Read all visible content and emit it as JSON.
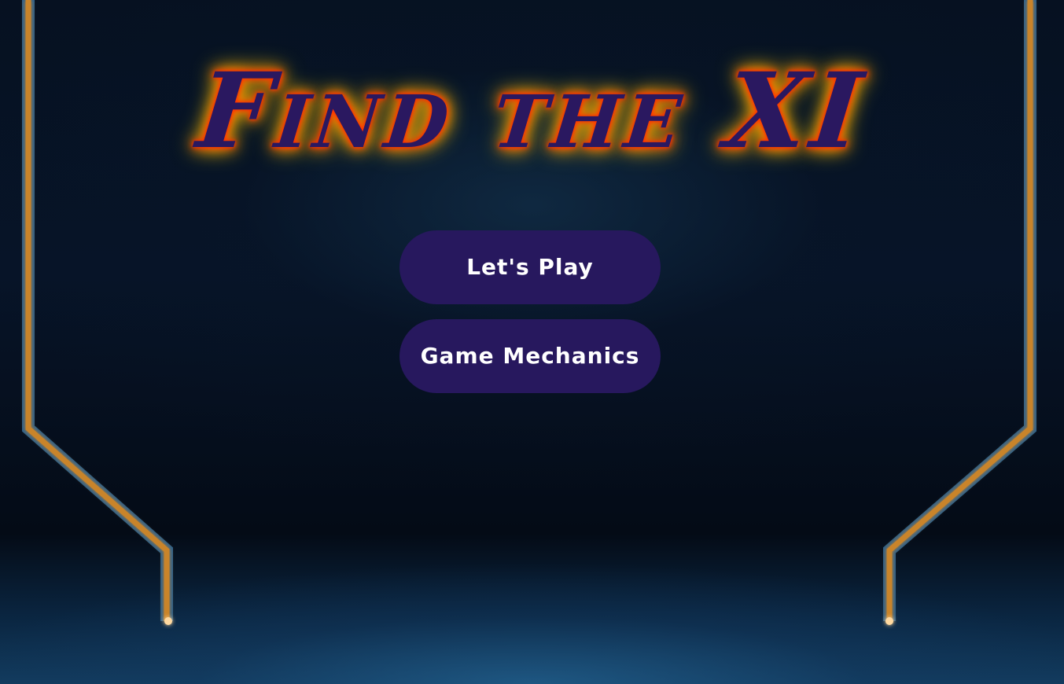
{
  "game": {
    "title": "Find the XI"
  },
  "menu": {
    "play_label": "Let's Play",
    "mechanics_label": "Game Mechanics"
  },
  "colors": {
    "button_bg": "#27185e",
    "button_text": "#ffffff",
    "title_fill": "#2a1860",
    "title_glow": "#ff5a00",
    "frame_orange": "#c9842a",
    "frame_blue": "#2a5f8c"
  }
}
